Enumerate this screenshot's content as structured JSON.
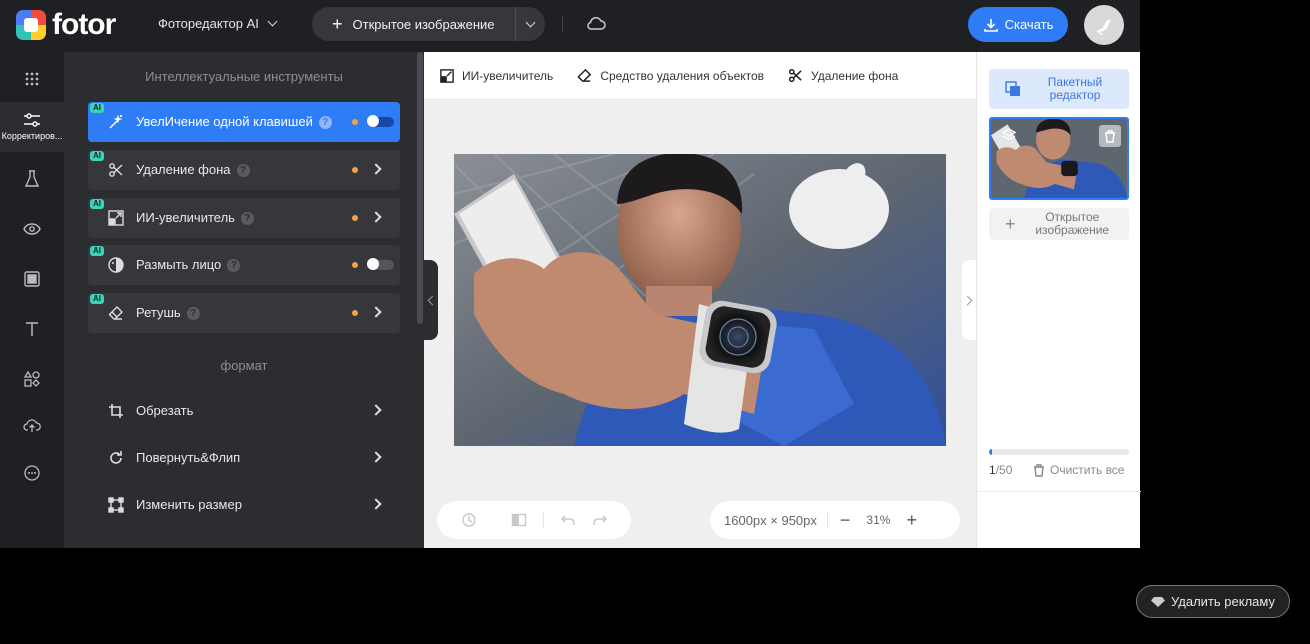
{
  "header": {
    "logo_text": "fotor",
    "editor_menu_label": "Фоторедактор AI",
    "open_image_label": "Открытое изображение",
    "download_label": "Скачать"
  },
  "rail": {
    "active_label": "Корректиров...",
    "items": [
      "apps-icon",
      "adjust-icon",
      "flask-icon",
      "eye-icon",
      "frame-icon",
      "text-icon",
      "elements-icon",
      "upload-cloud-icon",
      "more-icon"
    ]
  },
  "panel": {
    "ai_heading": "Интеллектуальные инструменты",
    "ai_badge": "AI",
    "tools": [
      {
        "label": "УвелИчение одной клавишей",
        "has_toggle": true,
        "toggle_on": true,
        "active": true
      },
      {
        "label": "Удаление фона",
        "has_toggle": false,
        "active": false
      },
      {
        "label": "ИИ-увеличитель",
        "has_toggle": false,
        "active": false
      },
      {
        "label": "Размыть лицо",
        "has_toggle": true,
        "toggle_on": false,
        "active": false
      },
      {
        "label": "Ретушь",
        "has_toggle": false,
        "active": false
      }
    ],
    "format_heading": "формат",
    "format_items": [
      "Обрезать",
      "Повернуть&Флип",
      "Изменить размер"
    ]
  },
  "canvas": {
    "toolbar": [
      "ИИ-увеличитель",
      "Средство удаления объектов",
      "Удаление фона"
    ],
    "image_size": "1600px × 950px",
    "zoom": "31%"
  },
  "right_panel": {
    "batch_label": "Пакетный редактор",
    "open_image_label": "Открытое изображение",
    "count_current": "1",
    "count_total": "/50",
    "progress": 0.02,
    "clear_all": "Очистить все"
  },
  "ad": {
    "remove_label": "Удалить рекламу"
  },
  "colors": {
    "accent": "#2f7df6",
    "dark_bg": "#1f2023",
    "panel_bg": "#2c2d31",
    "ai_badge": "#38d6b6",
    "dot": "#f5a340"
  }
}
